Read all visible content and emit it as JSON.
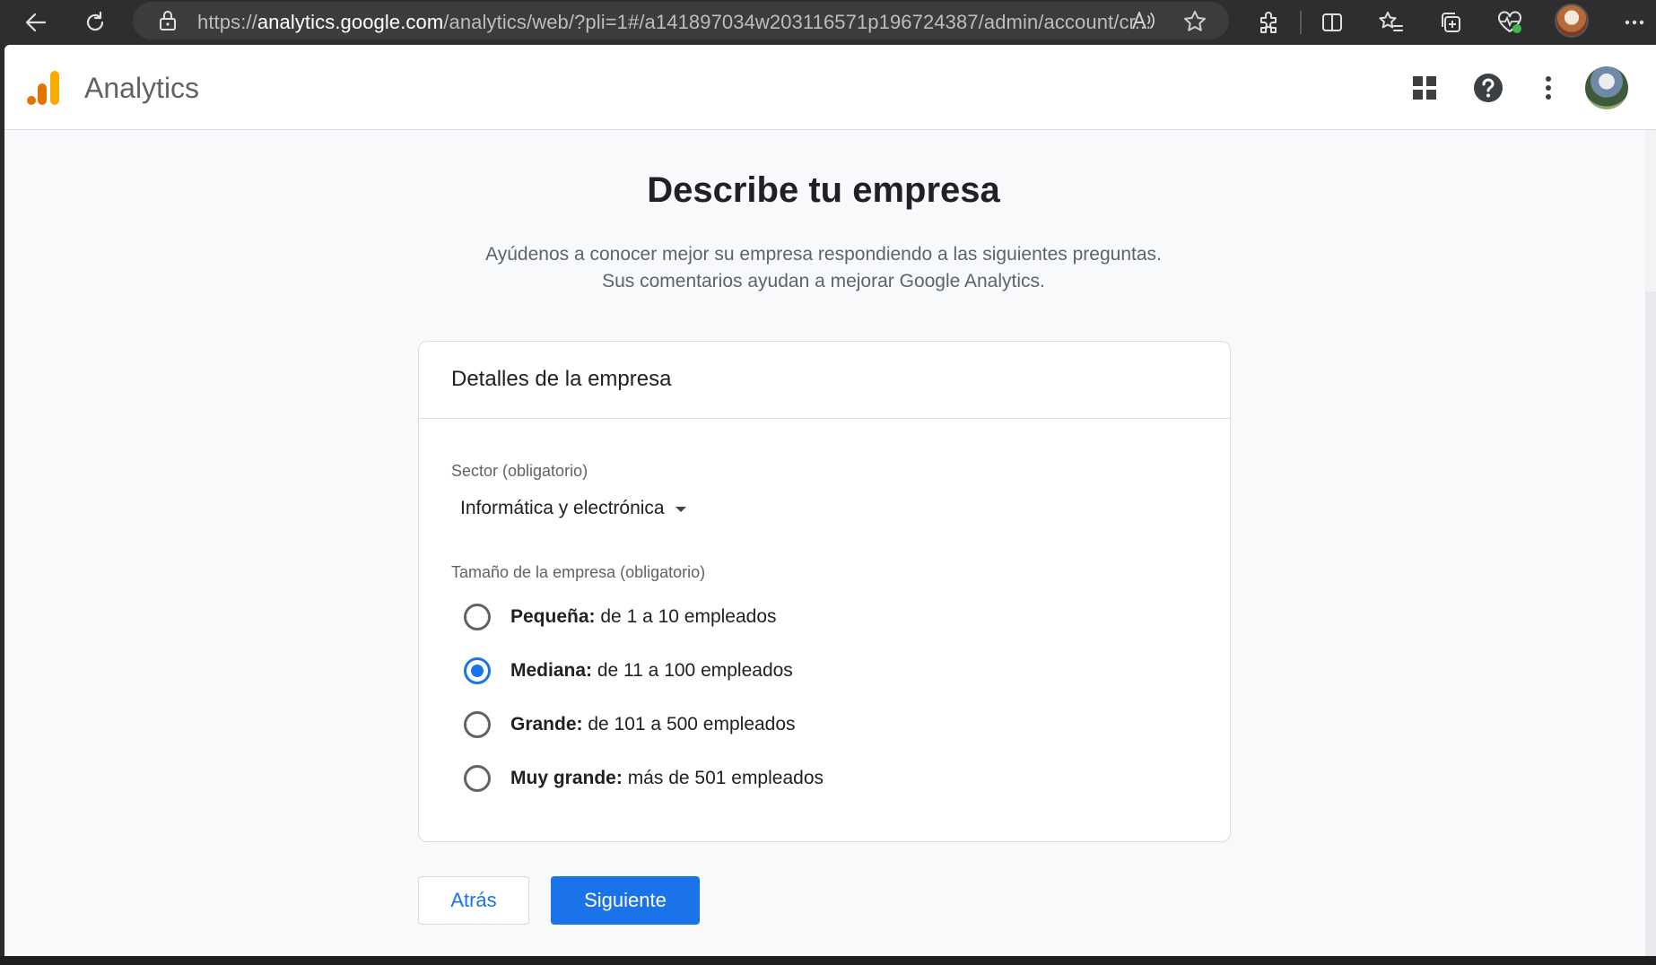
{
  "browser": {
    "url_prefix": "https://",
    "url_host": "analytics.google.com",
    "url_path": "/analytics/web/?pli=1#/a141897034w203116571p196724387/admin/account/cr..."
  },
  "header": {
    "app_title": "Analytics",
    "logo_colors": [
      "#F9AB00",
      "#E37400"
    ]
  },
  "page": {
    "title": "Describe tu empresa",
    "subtitle_line1": "Ayúdenos a conocer mejor su empresa respondiendo a las siguientes preguntas.",
    "subtitle_line2": "Sus comentarios ayudan a mejorar Google Analytics."
  },
  "card": {
    "title": "Detalles de la empresa",
    "sector_label": "Sector (obligatorio)",
    "sector_value": "Informática y electrónica",
    "size_label": "Tamaño de la empresa (obligatorio)",
    "size_options": [
      {
        "bold": "Pequeña:",
        "rest": "de 1 a 10 empleados",
        "checked": false
      },
      {
        "bold": "Mediana:",
        "rest": "de 11 a 100 empleados",
        "checked": true
      },
      {
        "bold": "Grande:",
        "rest": "de 101 a 500 empleados",
        "checked": false
      },
      {
        "bold": "Muy grande:",
        "rest": "más de 501 empleados",
        "checked": false
      }
    ]
  },
  "buttons": {
    "back": "Atrás",
    "next": "Siguiente"
  },
  "colors": {
    "accent": "#1a73e8",
    "text_primary": "#202124",
    "text_secondary": "#5f6368"
  }
}
